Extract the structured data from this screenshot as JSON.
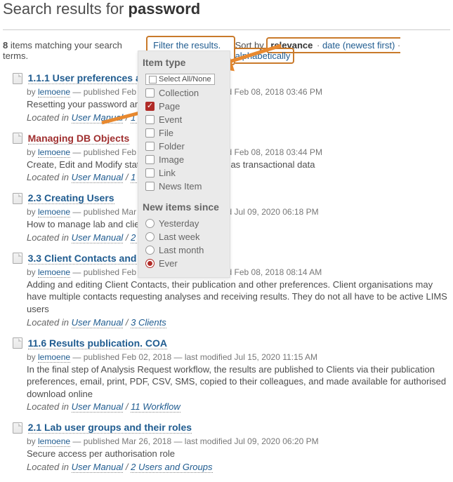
{
  "heading_prefix": "Search results for ",
  "heading_term": "password",
  "count": "8",
  "count_suffix": " items matching your search terms.",
  "filter_label": "Filter the results. ▼",
  "sort_by_label": "Sort by",
  "sort_current": "relevance",
  "sort_sep": " · ",
  "sort_date": "date (newest first)",
  "sort_alpha": "alphabetically",
  "dropdown": {
    "item_type_label": "Item type",
    "select_all_label": "Select All/None",
    "options": [
      {
        "label": "Collection",
        "checked": false
      },
      {
        "label": "Page",
        "checked": true
      },
      {
        "label": "Event",
        "checked": false
      },
      {
        "label": "File",
        "checked": false
      },
      {
        "label": "Folder",
        "checked": false
      },
      {
        "label": "Image",
        "checked": false
      },
      {
        "label": "Link",
        "checked": false
      },
      {
        "label": "News Item",
        "checked": false
      }
    ],
    "since_label": "New items since",
    "since_options": [
      {
        "label": "Yesterday",
        "checked": false
      },
      {
        "label": "Last week",
        "checked": false
      },
      {
        "label": "Last month",
        "checked": false
      },
      {
        "label": "Ever",
        "checked": true
      }
    ]
  },
  "results": [
    {
      "title": "1.1.1 User preferences and password",
      "visited": false,
      "author": "lemoene",
      "meta": " — published Feb 01, 2018 — last modified Feb 08, 2018 03:46 PM",
      "desc": "Resetting your password and avatar etc",
      "loc1": "User Manual",
      "loc2": "1 Introduction"
    },
    {
      "title": "Managing DB Objects",
      "visited": true,
      "author": "lemoene",
      "meta": " — published Feb 01, 2018 — last modified Feb 08, 2018 03:44 PM",
      "desc": "Create, Edit and Modify static setup items, as well as transactional data",
      "loc1": "User Manual",
      "loc2": "1 Introduction"
    },
    {
      "title": "2.3 Creating Users",
      "visited": false,
      "author": "lemoene",
      "meta": " — published Mar 26, 2018 — last modified Jul 09, 2020 06:18 PM",
      "desc": "How to manage lab and client users",
      "loc1": "User Manual",
      "loc2": "2 Users and Groups"
    },
    {
      "title": "3.3 Client Contacts and User preferences",
      "visited": false,
      "author": "lemoene",
      "meta": " — published Feb 08, 2018 — last modified Feb 08, 2018 08:14 AM",
      "desc": "Adding and editing Client Contacts, their publication and other preferences. Client organisations may have multiple contacts requesting analyses and receiving results. They do not all have to be active LIMS users",
      "loc1": "User Manual",
      "loc2": "3 Clients"
    },
    {
      "title": "11.6 Results publication. COA",
      "visited": false,
      "author": "lemoene",
      "meta": " — published Feb 02, 2018 — last modified Jul 15, 2020 11:15 AM",
      "desc": "In the final step of Analysis Request workflow, the results are published to Clients via their publication preferences, email, print, PDF, CSV, SMS, copied to their colleagues, and made available for authorised download online",
      "loc1": "User Manual",
      "loc2": "11 Workflow"
    },
    {
      "title": "2.1 Lab user groups and their roles",
      "visited": false,
      "author": "lemoene",
      "meta": " — published Mar 26, 2018 — last modified Jul 09, 2020 06:20 PM",
      "desc": "Secure access per authorisation role",
      "loc1": "User Manual",
      "loc2": "2 Users and Groups"
    }
  ],
  "labels": {
    "by": "by ",
    "located_in": "Located in ",
    "slash": " / "
  }
}
